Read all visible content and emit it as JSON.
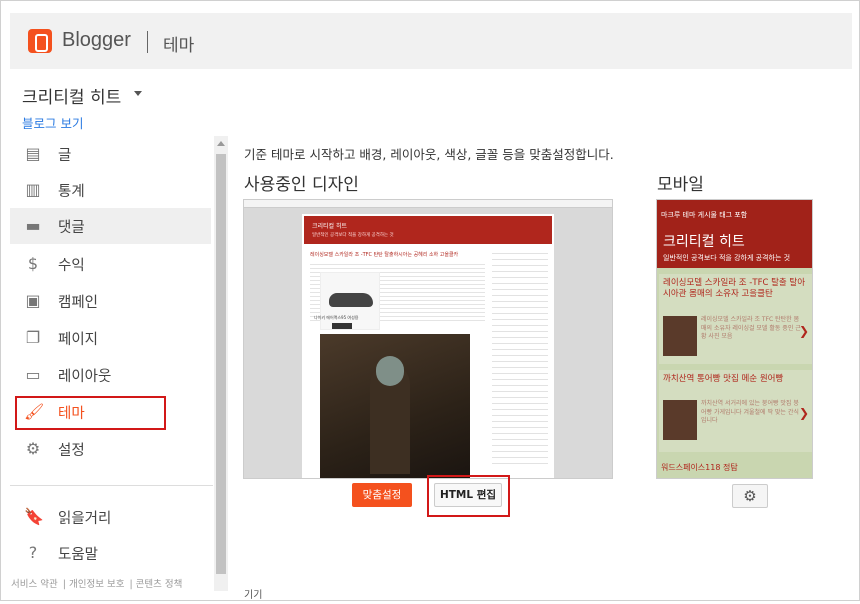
{
  "header": {
    "brand": "Blogger",
    "section": "테마"
  },
  "blog": {
    "name": "크리티컬 히트",
    "view_link": "블로그 보기"
  },
  "sidebar": {
    "items": [
      {
        "label": "글",
        "icon": "posts-icon",
        "glyph": "▤"
      },
      {
        "label": "통계",
        "icon": "stats-icon",
        "glyph": "▥"
      },
      {
        "label": "댓글",
        "icon": "comments-icon",
        "glyph": "▬"
      },
      {
        "label": "수익",
        "icon": "dollar-icon",
        "glyph": "$"
      },
      {
        "label": "캠페인",
        "icon": "campaign-icon",
        "glyph": "▣"
      },
      {
        "label": "페이지",
        "icon": "pages-icon",
        "glyph": "❐"
      },
      {
        "label": "레이아웃",
        "icon": "layout-icon",
        "glyph": "▭"
      },
      {
        "label": "테마",
        "icon": "theme-icon",
        "glyph": "🖌"
      },
      {
        "label": "설정",
        "icon": "settings-icon",
        "glyph": "⚙"
      }
    ],
    "bottom_items": [
      {
        "label": "읽을거리",
        "icon": "bookmark-icon",
        "glyph": "🔖"
      },
      {
        "label": "도움말",
        "icon": "help-icon",
        "glyph": "?"
      }
    ],
    "footer": [
      "서비스 약관",
      "개인정보 보호",
      "콘텐츠 정책"
    ]
  },
  "main": {
    "intro": "기준 테마로 시작하고 배경, 레이아웃, 색상, 글꼴 등을 맞춤설정합니다.",
    "current_design": "사용중인 디자인",
    "mobile": "모바일",
    "customize_button": "맞춤설정",
    "html_edit_button": "HTML 편집",
    "bottom_cut_text": "기기"
  },
  "desktop_preview": {
    "header_title": "크리티컬 히트",
    "header_sub": "일반적인 공격보다 적을 강하게 공격하는 것",
    "post_title": "레이싱모델 스카일라 조 -TFC 탄탄 탈출하시아는 공헤리 소하 고을클카",
    "shoe_caption": "나이키 에어맥스95 여성용"
  },
  "mobile_preview": {
    "top_small": "마크루 테마 게시물 태그 포함",
    "name": "크리티컬 히트",
    "desc": "일반적인 공격보다 적을 강하게 공격하는 것",
    "posts": [
      {
        "title": "레이싱모델 스카일라 조 -TFC 탈출 탈아시아관 몸매의 소유자 고을클탄",
        "text": "레이싱모델 스카일라 조 TFC 탄탄한 몸매의 소유자 레이싱걸 모델 활동 중인 근황 사진 모음"
      },
      {
        "title": "까치산역 통어빵 맛집 메순 원어빵",
        "text": "까치산역 서거리에 있는 붕어빵 맛집 붕어빵 가게입니다 겨울철에 딱 맞는 간식입니다"
      }
    ],
    "footer": "워드스페이스118 정탐"
  }
}
